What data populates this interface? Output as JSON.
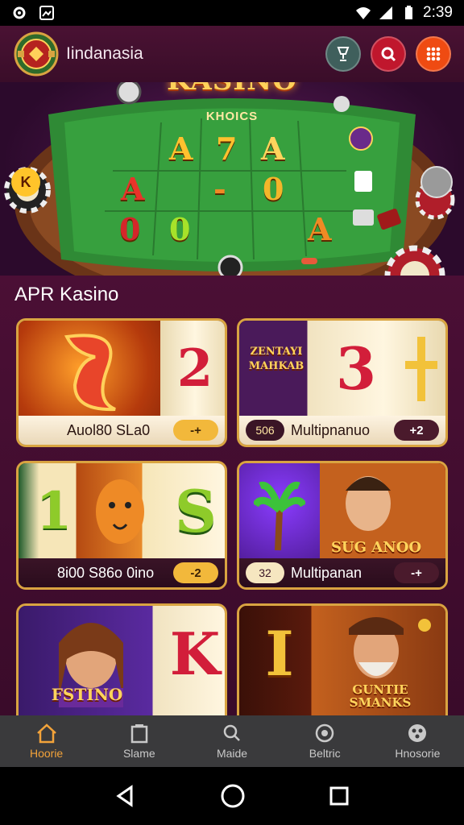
{
  "status_bar": {
    "time": "2:39"
  },
  "header": {
    "brand": "Iindanasia"
  },
  "hero": {
    "title": "KASINO",
    "subtitle": "KHOICS",
    "felt_symbols": [
      "A",
      "7",
      "A",
      "A",
      "-",
      "0",
      "0",
      "0",
      "A"
    ]
  },
  "section": {
    "title": "APR Kasino"
  },
  "cards": [
    {
      "name": "Auol80 SLa0",
      "pill": "-+",
      "reels": [
        "2"
      ]
    },
    {
      "name": "Multipnanuo",
      "pill_left": "506",
      "pill": "+2",
      "art_label": "ZENTAYI MAHKAB",
      "reels": [
        "3"
      ]
    },
    {
      "name": "8i00 S86o 0ino",
      "pill": "-2",
      "reels": [
        "1",
        "S"
      ]
    },
    {
      "name": "Multipanan",
      "pill_left": "32",
      "pill": "-+",
      "art_label": "SUG ANOO"
    },
    {
      "name": "",
      "art_label": "FSTINO",
      "reels": [
        "K"
      ]
    },
    {
      "name": "",
      "art_label": "GUNTIE SMANKS",
      "reels": [
        "I"
      ]
    }
  ],
  "bottom_nav": [
    {
      "label": "Hoorie",
      "icon": "home-icon"
    },
    {
      "label": "Slame",
      "icon": "slots-icon"
    },
    {
      "label": "Maide",
      "icon": "search-icon"
    },
    {
      "label": "Beltric",
      "icon": "chip-icon"
    },
    {
      "label": "Hnosorie",
      "icon": "dice-icon"
    }
  ],
  "colors": {
    "accent": "#f3a33a",
    "gold": "#d9a441",
    "bg": "#4b0f35",
    "felt": "#2f8a35"
  }
}
